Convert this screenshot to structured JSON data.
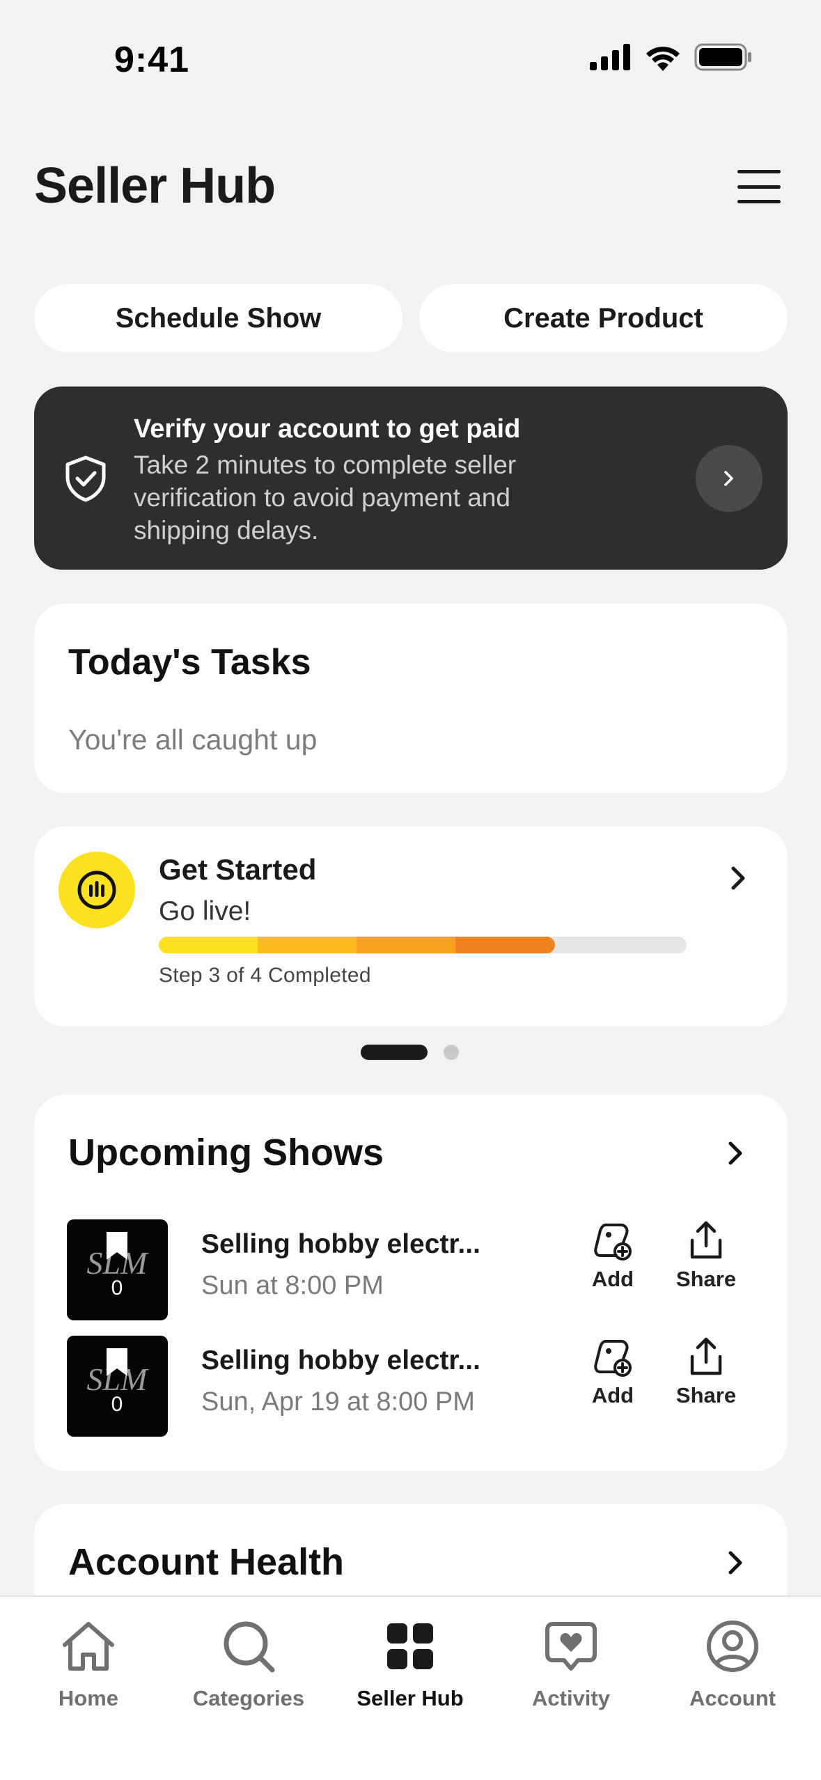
{
  "status_bar": {
    "time": "9:41",
    "icons": [
      "signal-icon",
      "wifi-icon",
      "battery-icon"
    ]
  },
  "header": {
    "title": "Seller Hub",
    "menu_icon": "hamburger-menu-icon"
  },
  "quick_actions": {
    "schedule_show": "Schedule Show",
    "create_product": "Create Product"
  },
  "verify_banner": {
    "title": "Verify your account to get paid",
    "description": "Take 2 minutes to complete seller verification to avoid payment and shipping delays.",
    "icon": "shield-check-icon"
  },
  "tasks": {
    "title": "Today's Tasks",
    "empty_message": "You're all caught up"
  },
  "get_started": {
    "title": "Get Started",
    "subtitle": "Go live!",
    "step_text": "Step 3 of 4 Completed",
    "progress": 0.75,
    "colors": [
      "#fde11e",
      "#fbbb1e",
      "#f8a11f",
      "#f2821f"
    ]
  },
  "carousel": {
    "page": 1,
    "total": 2
  },
  "upcoming_shows": {
    "title": "Upcoming Shows",
    "items": [
      {
        "title": "Selling hobby electr...",
        "time": "Sun at 8:00 PM",
        "thumb_count": "0",
        "add_label": "Add",
        "share_label": "Share"
      },
      {
        "title": "Selling hobby electr...",
        "time": "Sun, Apr 19 at 8:00 PM",
        "thumb_count": "0",
        "add_label": "Add",
        "share_label": "Share"
      }
    ]
  },
  "account_health": {
    "title": "Account Health"
  },
  "tabbar": {
    "items": [
      {
        "label": "Home",
        "icon": "home-icon"
      },
      {
        "label": "Categories",
        "icon": "search-icon"
      },
      {
        "label": "Seller Hub",
        "icon": "grid-icon",
        "active": true
      },
      {
        "label": "Activity",
        "icon": "chat-heart-icon"
      },
      {
        "label": "Account",
        "icon": "user-icon"
      }
    ]
  }
}
